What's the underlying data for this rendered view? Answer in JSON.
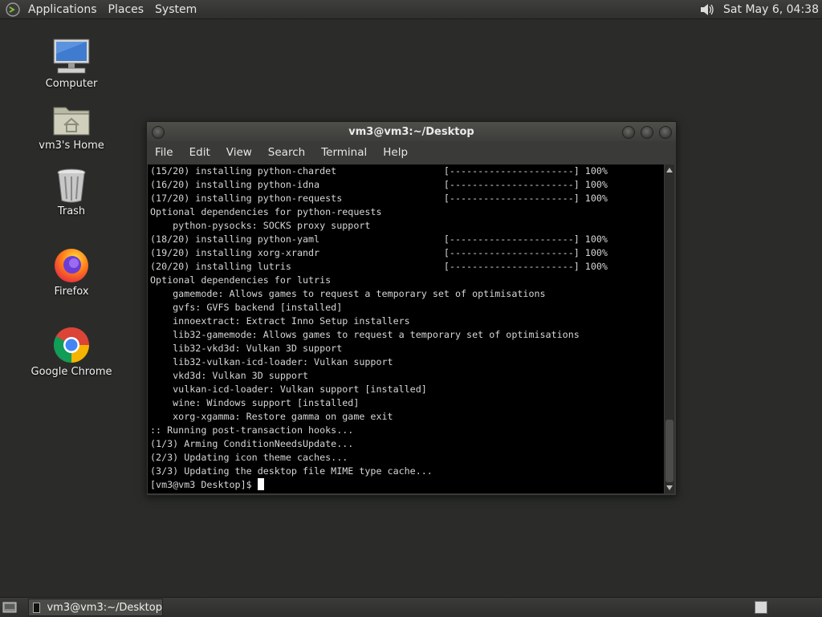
{
  "top_panel": {
    "menus": [
      "Applications",
      "Places",
      "System"
    ],
    "clock": "Sat May  6, 04:38"
  },
  "desktop_icons": [
    {
      "label": "Computer",
      "icon": "computer-icon"
    },
    {
      "label": "vm3's Home",
      "icon": "home-folder-icon"
    },
    {
      "label": "Trash",
      "icon": "trash-icon"
    },
    {
      "label": "Firefox",
      "icon": "firefox-icon"
    },
    {
      "label": "Google Chrome",
      "icon": "chrome-icon"
    }
  ],
  "terminal": {
    "title": "vm3@vm3:~/Desktop",
    "menu": [
      "File",
      "Edit",
      "View",
      "Search",
      "Terminal",
      "Help"
    ],
    "lines": [
      "(15/20) installing python-chardet                   [----------------------] 100%",
      "(16/20) installing python-idna                      [----------------------] 100%",
      "(17/20) installing python-requests                  [----------------------] 100%",
      "Optional dependencies for python-requests",
      "    python-pysocks: SOCKS proxy support",
      "(18/20) installing python-yaml                      [----------------------] 100%",
      "(19/20) installing xorg-xrandr                      [----------------------] 100%",
      "(20/20) installing lutris                           [----------------------] 100%",
      "Optional dependencies for lutris",
      "    gamemode: Allows games to request a temporary set of optimisations",
      "    gvfs: GVFS backend [installed]",
      "    innoextract: Extract Inno Setup installers",
      "    lib32-gamemode: Allows games to request a temporary set of optimisations",
      "    lib32-vkd3d: Vulkan 3D support",
      "    lib32-vulkan-icd-loader: Vulkan support",
      "    vkd3d: Vulkan 3D support",
      "    vulkan-icd-loader: Vulkan support [installed]",
      "    wine: Windows support [installed]",
      "    xorg-xgamma: Restore gamma on game exit",
      ":: Running post-transaction hooks...",
      "(1/3) Arming ConditionNeedsUpdate...",
      "(2/3) Updating icon theme caches...",
      "(3/3) Updating the desktop file MIME type cache..."
    ],
    "prompt": "[vm3@vm3 Desktop]$ "
  },
  "taskbar": {
    "task_label": "vm3@vm3:~/Desktop"
  }
}
